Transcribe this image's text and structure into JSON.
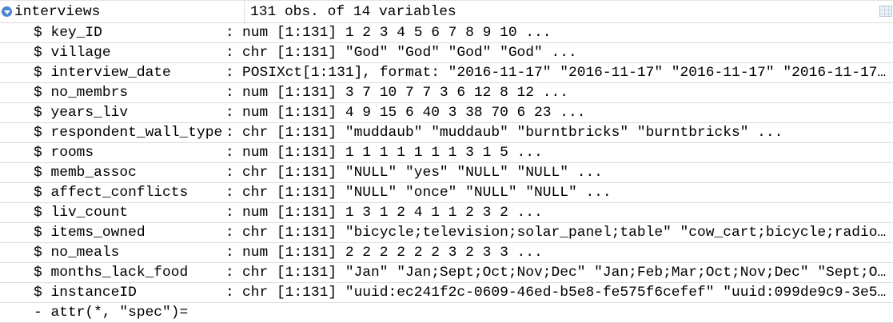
{
  "object": {
    "name": "interviews",
    "summary": "131 obs. of 14 variables"
  },
  "variables": [
    {
      "name": "$ key_ID",
      "value": "num [1:131] 1 2 3 4 5 6 7 8 9 10 ..."
    },
    {
      "name": "$ village",
      "value": "chr [1:131] \"God\" \"God\" \"God\" \"God\" ..."
    },
    {
      "name": "$ interview_date",
      "value": "POSIXct[1:131], format: \"2016-11-17\" \"2016-11-17\" \"2016-11-17\" \"2016-11-17…"
    },
    {
      "name": "$ no_membrs",
      "value": "num [1:131] 3 7 10 7 7 3 6 12 8 12 ..."
    },
    {
      "name": "$ years_liv",
      "value": "num [1:131] 4 9 15 6 40 3 38 70 6 23 ..."
    },
    {
      "name": "$ respondent_wall_type",
      "value": "chr [1:131] \"muddaub\" \"muddaub\" \"burntbricks\" \"burntbricks\" ..."
    },
    {
      "name": "$ rooms",
      "value": "num [1:131] 1 1 1 1 1 1 1 3 1 5 ..."
    },
    {
      "name": "$ memb_assoc",
      "value": "chr [1:131] \"NULL\" \"yes\" \"NULL\" \"NULL\" ..."
    },
    {
      "name": "$ affect_conflicts",
      "value": "chr [1:131] \"NULL\" \"once\" \"NULL\" \"NULL\" ..."
    },
    {
      "name": "$ liv_count",
      "value": "num [1:131] 1 3 1 2 4 1 1 2 3 2 ..."
    },
    {
      "name": "$ items_owned",
      "value": "chr [1:131] \"bicycle;television;solar_panel;table\" \"cow_cart;bicycle;radio…"
    },
    {
      "name": "$ no_meals",
      "value": "num [1:131] 2 2 2 2 2 2 3 2 3 3 ..."
    },
    {
      "name": "$ months_lack_food",
      "value": "chr [1:131] \"Jan\" \"Jan;Sept;Oct;Nov;Dec\" \"Jan;Feb;Mar;Oct;Nov;Dec\" \"Sept;O…"
    },
    {
      "name": "$ instanceID",
      "value": "chr [1:131] \"uuid:ec241f2c-0609-46ed-b5e8-fe575f6cefef\" \"uuid:099de9c9-3e5…"
    }
  ],
  "separator": ":",
  "attr_line": "- attr(*, \"spec\")="
}
